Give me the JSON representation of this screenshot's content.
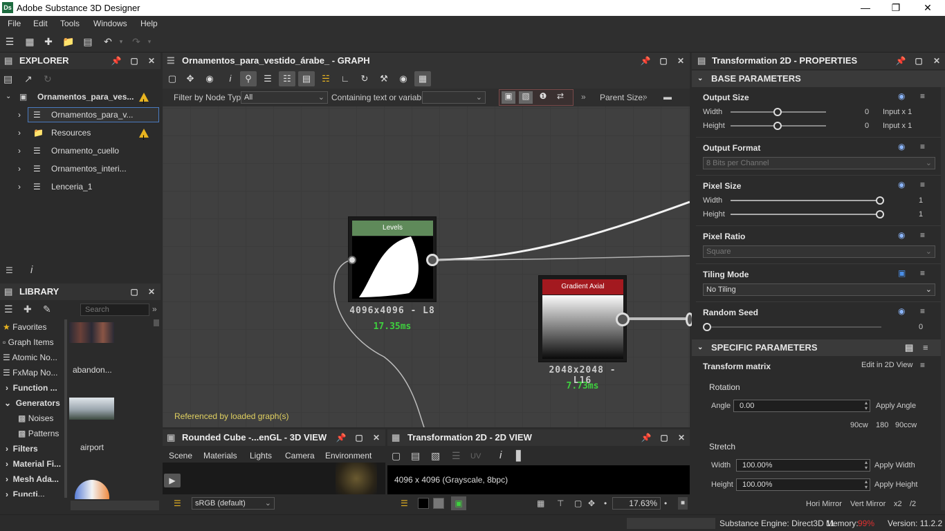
{
  "app": {
    "title": "Adobe Substance 3D Designer",
    "logo": "Ds"
  },
  "menu": [
    "File",
    "Edit",
    "Tools",
    "Windows",
    "Help"
  ],
  "explorer": {
    "title": "EXPLORER",
    "root": "Ornamentos_para_ves...",
    "items": [
      "Ornamentos_para_v...",
      "Resources",
      "Ornamento_cuello",
      "Ornamentos_interi...",
      "Lenceria_1"
    ]
  },
  "library": {
    "title": "LIBRARY",
    "search_placeholder": "Search",
    "categories": [
      "Favorites",
      "Graph Items",
      "Atomic No...",
      "FxMap No...",
      "Function ...",
      "Generators",
      "Noises",
      "Patterns",
      "Filters",
      "Material Fi...",
      "Mesh Ada...",
      "Functi..."
    ],
    "thumbs": [
      "abandon...",
      "airport"
    ]
  },
  "graph": {
    "title": "Ornamentos_para_vestido_árabe_ - GRAPH",
    "filter_label": "Filter by Node Type",
    "filter_value": "All",
    "containing_label": "Containing text or variable",
    "parent_size": "Parent Size:",
    "footer_note": "Referenced by loaded graph(s)",
    "nodes": [
      {
        "name": "Levels",
        "resolution": "4096x4096 - L8",
        "time": "17.35ms",
        "header_color": "#5f8a5a"
      },
      {
        "name": "Gradient Axial",
        "resolution": "2048x2048 - L16",
        "time": "7.73ms",
        "header_color": "#a3191f"
      }
    ]
  },
  "view3d": {
    "title": "Rounded Cube -...enGL - 3D VIEW",
    "tabs": [
      "Scene",
      "Materials",
      "Lights",
      "Camera",
      "Environment"
    ],
    "colorspace": "sRGB (default)"
  },
  "view2d": {
    "title": "Transformation 2D - 2D VIEW",
    "info": "4096 x 4096 (Grayscale, 8bpc)",
    "uv": "UV",
    "zoom": "17.63%"
  },
  "props": {
    "title": "Transformation 2D - PROPERTIES",
    "base_section": "BASE PARAMETERS",
    "specific_section": "SPECIFIC PARAMETERS",
    "output_size": {
      "label": "Output Size",
      "width_label": "Width",
      "height_label": "Height",
      "width_val": "0",
      "height_val": "0",
      "width_mode": "Input x 1",
      "height_mode": "Input x 1"
    },
    "output_format": {
      "label": "Output Format",
      "value": "8 Bits per Channel"
    },
    "pixel_size": {
      "label": "Pixel Size",
      "width_label": "Width",
      "height_label": "Height",
      "width_val": "1",
      "height_val": "1"
    },
    "pixel_ratio": {
      "label": "Pixel Ratio",
      "value": "Square"
    },
    "tiling": {
      "label": "Tiling Mode",
      "value": "No Tiling"
    },
    "seed": {
      "label": "Random Seed",
      "value": "0"
    },
    "transform": {
      "label": "Transform matrix",
      "edit": "Edit in 2D View",
      "rotation": "Rotation",
      "angle_label": "Angle",
      "angle_val": "0.00",
      "apply_angle": "Apply Angle",
      "rot_buttons": [
        "90cw",
        "180",
        "90ccw"
      ],
      "stretch": "Stretch",
      "width_label": "Width",
      "width_val": "100.00%",
      "apply_width": "Apply Width",
      "height_label": "Height",
      "height_val": "100.00%",
      "apply_height": "Apply Height",
      "mirror": [
        "Hori Mirror",
        "Vert Mirror",
        "x2",
        "/2"
      ]
    }
  },
  "status": {
    "engine": "Substance Engine: Direct3D 11",
    "memory_label": "Memory:",
    "memory_val": "99%",
    "version": "Version: 11.2.2"
  }
}
